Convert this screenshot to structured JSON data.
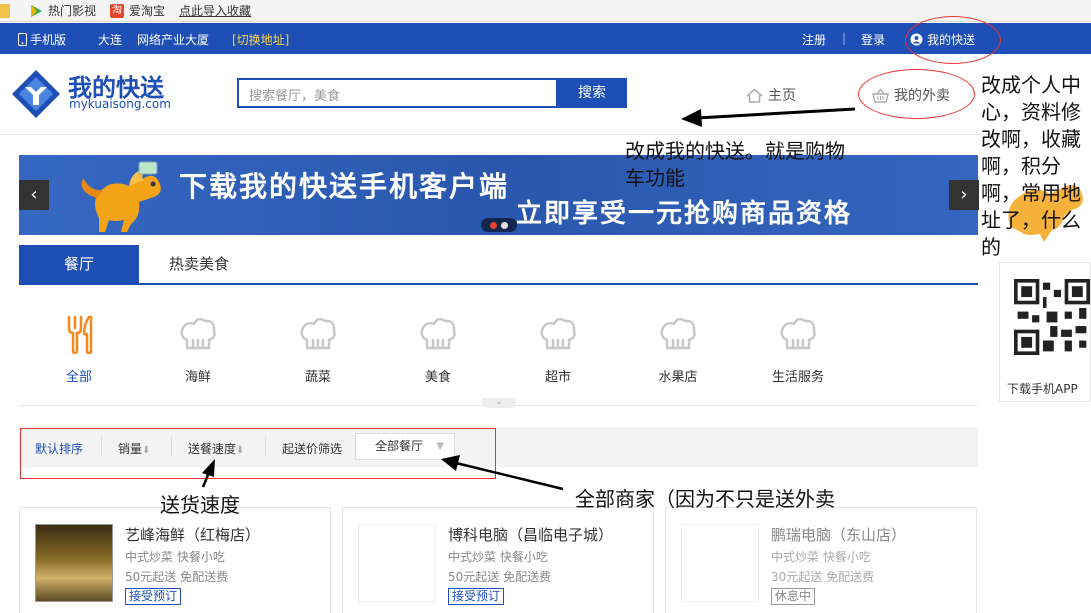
{
  "bookmarks": [
    {
      "label": "热门影视",
      "icon": "play-icon"
    },
    {
      "label": "爱淘宝",
      "icon": "taobao-icon"
    },
    {
      "label": "点此导入收藏",
      "icon": ""
    }
  ],
  "topbar": {
    "mobile": "手机版",
    "city": "大连",
    "area": "网络产业大厦",
    "switch": "[切换地址]",
    "register": "注册",
    "separator": "|",
    "login": "登录",
    "my_express": "我的快送"
  },
  "header": {
    "logo_title": "我的快送",
    "logo_sub": "mykuaisong.com",
    "search_placeholder": "搜索餐厅，美食",
    "search_button": "搜索",
    "nav_home": "主页",
    "nav_takeout": "我的外卖"
  },
  "banner": {
    "line1": "下载我的快送手机客户端",
    "line2": "立即享受一元抢购商品资格",
    "prev": "‹",
    "next": "›"
  },
  "tabs": [
    "餐厅",
    "热卖美食"
  ],
  "categories": [
    "全部",
    "海鲜",
    "蔬菜",
    "美食",
    "超市",
    "水果店",
    "生活服务"
  ],
  "sortbar": {
    "default": "默认排序",
    "sales": "销量",
    "speed": "送餐速度",
    "min_price": "起送价筛选",
    "all_shops": "全部餐厅",
    "arrow": "⬇"
  },
  "sidebar": {
    "qr_label": "下载手机APP"
  },
  "shops": [
    {
      "name": "艺峰海鲜（红梅店）",
      "cuisine": "中式炒菜  快餐小吃",
      "delivery": "50元起送  免配送费",
      "badge": "接受预订",
      "closed": false
    },
    {
      "name": "博科电脑（昌临电子城）",
      "cuisine": "中式炒菜  快餐小吃",
      "delivery": "50元起送  免配送费",
      "badge": "接受预订",
      "closed": false
    },
    {
      "name": "鹏瑞电脑（东山店）",
      "cuisine": "中式炒菜  快餐小吃",
      "delivery": "30元起送  免配送费",
      "badge": "休息中",
      "closed": true
    }
  ],
  "annotations": {
    "cart": "改成我的快送。就是购物车功能",
    "profile": "改成个人中心，资料修改啊，收藏啊，积分啊，常用地址了，什么的",
    "speed": "送货速度",
    "all_shops": "全部商家（因为不只是送外卖"
  },
  "colors": {
    "brand": "#1d4fb7",
    "annotation_red": "#e33333",
    "accent_orange": "#f39800"
  }
}
